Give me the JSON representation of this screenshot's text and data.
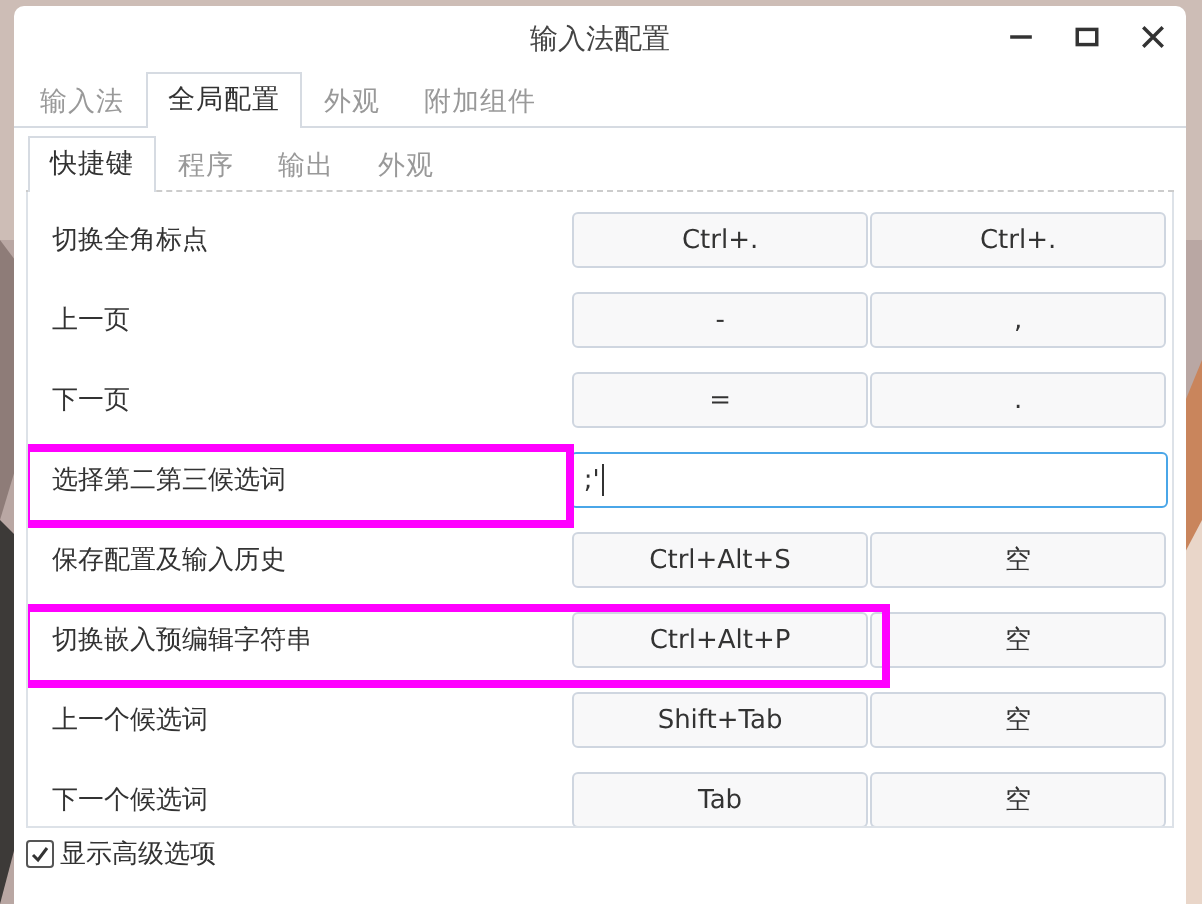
{
  "window": {
    "title": "输入法配置"
  },
  "tabs": [
    {
      "label": "输入法",
      "selected": false
    },
    {
      "label": "全局配置",
      "selected": true
    },
    {
      "label": "外观",
      "selected": false
    },
    {
      "label": "附加组件",
      "selected": false
    }
  ],
  "subtabs": [
    {
      "label": "快捷键",
      "selected": true
    },
    {
      "label": "程序",
      "selected": false
    },
    {
      "label": "输出",
      "selected": false
    },
    {
      "label": "外观",
      "selected": false
    }
  ],
  "rows": [
    {
      "label": "切换全角标点",
      "kind": "keys",
      "keys": [
        "Ctrl+.",
        "Ctrl+."
      ],
      "marked": false
    },
    {
      "label": "上一页",
      "kind": "keys",
      "keys": [
        "-",
        ","
      ],
      "marked": false
    },
    {
      "label": "下一页",
      "kind": "keys",
      "keys": [
        "=",
        "."
      ],
      "marked": false
    },
    {
      "label": "选择第二第三候选词",
      "kind": "field",
      "value": ";'",
      "marked": true
    },
    {
      "label": "保存配置及输入历史",
      "kind": "keys",
      "keys": [
        "Ctrl+Alt+S",
        "空"
      ],
      "marked": false
    },
    {
      "label": "切换嵌入预编辑字符串",
      "kind": "keys",
      "keys": [
        "Ctrl+Alt+P",
        "空"
      ],
      "marked": true
    },
    {
      "label": "上一个候选词",
      "kind": "keys",
      "keys": [
        "Shift+Tab",
        "空"
      ],
      "marked": false
    },
    {
      "label": "下一个候选词",
      "kind": "keys",
      "keys": [
        "Tab",
        "空"
      ],
      "marked": false
    }
  ],
  "advanced": {
    "label": "显示高级选项",
    "checked": true
  }
}
